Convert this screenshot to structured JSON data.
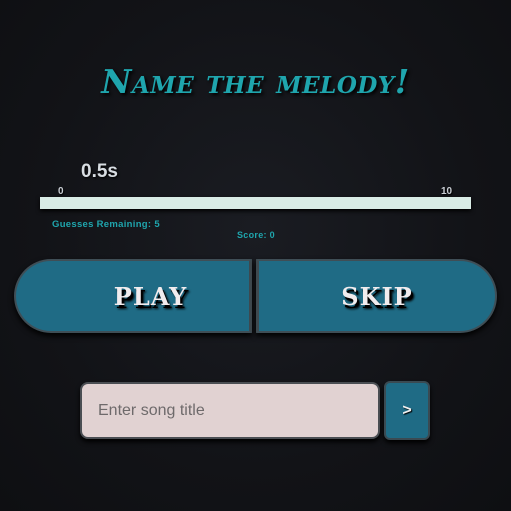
{
  "header": {
    "title": "Name the melody!"
  },
  "timeline": {
    "current_time_label": "0.5s",
    "min_label": "0",
    "max_label": "10",
    "progress_fraction": 0
  },
  "status": {
    "guesses_remaining": "Guesses Remaining: 5",
    "score": "Score: 0"
  },
  "controls": {
    "play_label": "PLAY",
    "skip_label": "SKIP"
  },
  "guess_form": {
    "placeholder": "Enter song title",
    "value": "",
    "submit_label": ">"
  },
  "colors": {
    "accent": "#1fa5ad",
    "button": "#1f6b85",
    "track": "#d9ece6",
    "input_bg": "#e1d2d2",
    "background": "#121317"
  }
}
